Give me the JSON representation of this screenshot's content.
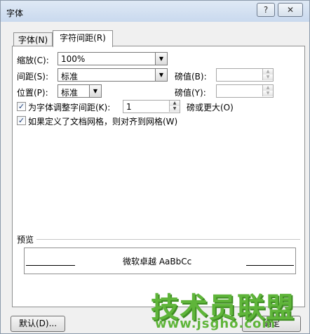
{
  "window": {
    "title": "字体",
    "help_label": "?",
    "close_label": "✕"
  },
  "tabs": [
    {
      "label": "字体(N)",
      "active": false
    },
    {
      "label": "字符间距(R)",
      "active": true
    }
  ],
  "scale": {
    "label": "缩放(C):",
    "value": "100%"
  },
  "spacing": {
    "label": "间距(S):",
    "value": "标准",
    "pt_label": "磅值(B):",
    "pt_value": ""
  },
  "position": {
    "label": "位置(P):",
    "value": "标准",
    "pt_label": "磅值(Y):",
    "pt_value": ""
  },
  "kerning": {
    "label": "为字体调整字间距(K):",
    "checked": true,
    "value": "1",
    "suffix": "磅或更大(O)"
  },
  "snap_grid": {
    "label": "如果定义了文档网格，则对齐到网格(W)",
    "checked": true
  },
  "preview": {
    "label": "预览",
    "sample": "微软卓越  AaBbCc"
  },
  "buttons": {
    "default_label": "默认(D)...",
    "ok_label": "确定"
  },
  "watermark": {
    "text": "技术员联盟",
    "url": "www.jsgho.com"
  },
  "icons": {
    "checkbox": "check-icon",
    "dropdown": "triangle-down-icon",
    "spin_up": "triangle-up-icon",
    "spin_down": "triangle-down-icon"
  }
}
